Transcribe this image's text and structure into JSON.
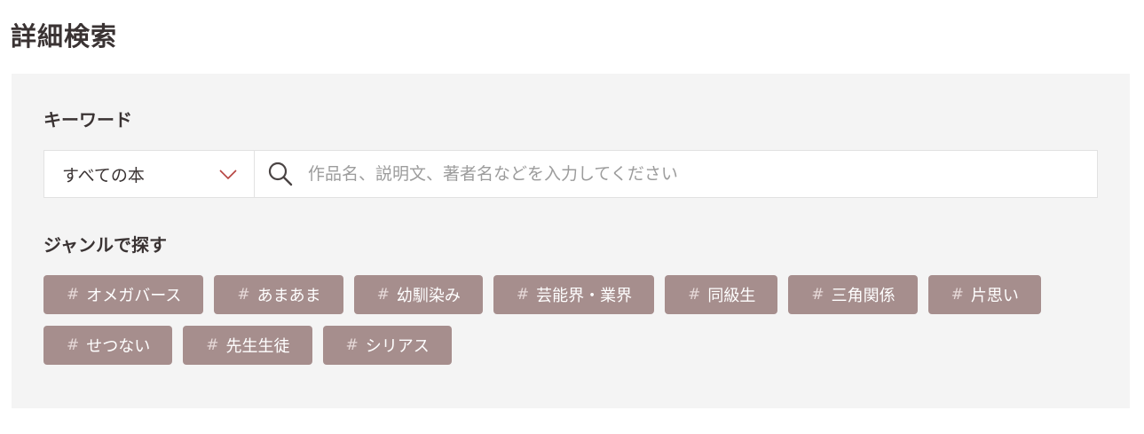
{
  "page": {
    "title": "詳細検索"
  },
  "keyword": {
    "label": "キーワード",
    "scope_value": "すべての本",
    "placeholder": "作品名、説明文、著者名などを入力してください",
    "value": ""
  },
  "genre": {
    "label": "ジャンルで探す",
    "hash_symbol": "#",
    "tags": [
      "オメガバース",
      "あまあま",
      "幼馴染み",
      "芸能界・業界",
      "同級生",
      "三角関係",
      "片思い",
      "せつない",
      "先生生徒",
      "シリアス"
    ]
  },
  "colors": {
    "panel_bg": "#f4f4f4",
    "tag_bg": "#a68e8d",
    "chevron": "#b5413e",
    "text": "#3a3333"
  },
  "icons": {
    "search": "search-icon",
    "dropdown": "chevron-down-icon"
  }
}
